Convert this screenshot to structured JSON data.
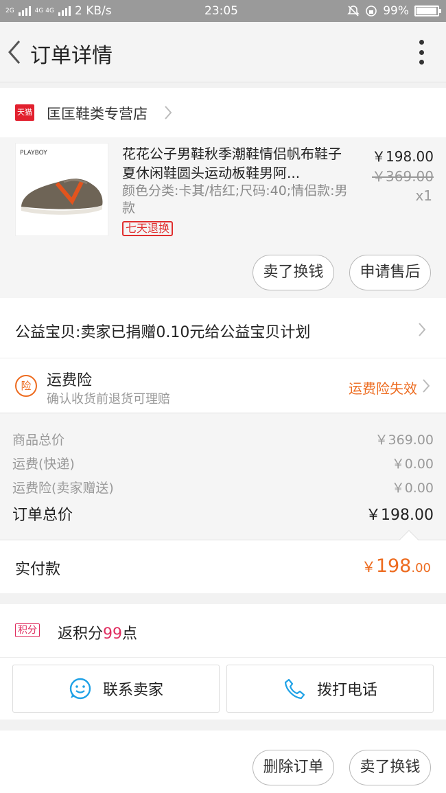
{
  "status_bar": {
    "network_1": "2G",
    "network_2": "4G 4G",
    "speed": "2 KB/s",
    "time": "23:05",
    "battery": "99%"
  },
  "header": {
    "title": "订单详情"
  },
  "shop": {
    "badge": "天猫",
    "name": "匡匡鞋类专营店"
  },
  "product": {
    "image_brand": "PLAYBOY",
    "title": "花花公子男鞋秋季潮鞋情侣帆布鞋子夏休闲鞋圆头运动板鞋男阿...",
    "spec": "颜色分类:卡其/桔红;尺码:40;情侣款:男款",
    "tag": "七天退换",
    "price": "￥198.00",
    "original_price": "￥369.00",
    "quantity": "x1",
    "buttons": [
      "卖了换钱",
      "申请售后"
    ]
  },
  "charity": {
    "text": "公益宝贝:卖家已捐赠0.10元给公益宝贝计划"
  },
  "insurance": {
    "icon_text": "险",
    "title": "运费险",
    "subtitle": "确认收货前退货可理赔",
    "status": "运费险失效"
  },
  "totals": [
    {
      "label": "商品总价",
      "value": "￥369.00"
    },
    {
      "label": "运费(快递)",
      "value": "￥0.00"
    },
    {
      "label": "运费险(卖家赠送)",
      "value": "￥0.00"
    },
    {
      "label": "订单总价",
      "value": "￥198.00"
    }
  ],
  "paid": {
    "label": "实付款",
    "currency": "￥",
    "integer": "198",
    "decimal": ".00"
  },
  "points": {
    "badge": "积分",
    "prefix": "返积分",
    "number": "99",
    "suffix": "点"
  },
  "actions": {
    "contact_label": "联系卖家",
    "call_label": "拨打电话"
  },
  "bottom_buttons": [
    "删除订单",
    "卖了换钱"
  ],
  "colors": {
    "accent_orange": "#ed6b1f",
    "tmall_red": "#e2202e",
    "points_pink": "#e02e60",
    "icon_blue": "#1ea1e6"
  }
}
